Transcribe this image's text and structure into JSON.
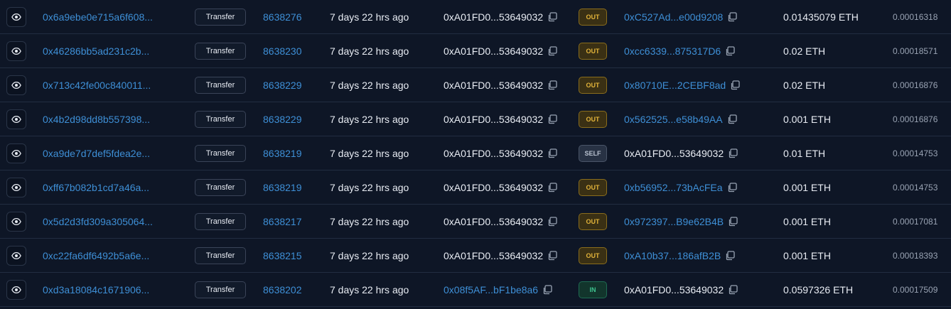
{
  "colors": {
    "background": "#0e1626",
    "link": "#3e8fd6",
    "out_badge": "#e2b33a",
    "self_badge": "#b8c1cf",
    "in_badge": "#3fc38f"
  },
  "rows": [
    {
      "hash": "0x6a9ebe0e715a6f608...",
      "method": "Transfer",
      "block": "8638276",
      "age": "7 days 22 hrs ago",
      "from": "0xA01FD0...53649032",
      "from_is_link": false,
      "direction": "OUT",
      "to": "0xC527Ad...e00d9208",
      "to_is_link": true,
      "value": "0.01435079 ETH",
      "fee": "0.00016318"
    },
    {
      "hash": "0x46286bb5ad231c2b...",
      "method": "Transfer",
      "block": "8638230",
      "age": "7 days 22 hrs ago",
      "from": "0xA01FD0...53649032",
      "from_is_link": false,
      "direction": "OUT",
      "to": "0xcc6339...875317D6",
      "to_is_link": true,
      "value": "0.02 ETH",
      "fee": "0.00018571"
    },
    {
      "hash": "0x713c42fe00c840011...",
      "method": "Transfer",
      "block": "8638229",
      "age": "7 days 22 hrs ago",
      "from": "0xA01FD0...53649032",
      "from_is_link": false,
      "direction": "OUT",
      "to": "0x80710E...2CEBF8ad",
      "to_is_link": true,
      "value": "0.02 ETH",
      "fee": "0.00016876"
    },
    {
      "hash": "0x4b2d98dd8b557398...",
      "method": "Transfer",
      "block": "8638229",
      "age": "7 days 22 hrs ago",
      "from": "0xA01FD0...53649032",
      "from_is_link": false,
      "direction": "OUT",
      "to": "0x562525...e58b49AA",
      "to_is_link": true,
      "value": "0.001 ETH",
      "fee": "0.00016876"
    },
    {
      "hash": "0xa9de7d7def5fdea2e...",
      "method": "Transfer",
      "block": "8638219",
      "age": "7 days 22 hrs ago",
      "from": "0xA01FD0...53649032",
      "from_is_link": false,
      "direction": "SELF",
      "to": "0xA01FD0...53649032",
      "to_is_link": false,
      "value": "0.01 ETH",
      "fee": "0.00014753"
    },
    {
      "hash": "0xff67b082b1cd7a46a...",
      "method": "Transfer",
      "block": "8638219",
      "age": "7 days 22 hrs ago",
      "from": "0xA01FD0...53649032",
      "from_is_link": false,
      "direction": "OUT",
      "to": "0xb56952...73bAcFEa",
      "to_is_link": true,
      "value": "0.001 ETH",
      "fee": "0.00014753"
    },
    {
      "hash": "0x5d2d3fd309a305064...",
      "method": "Transfer",
      "block": "8638217",
      "age": "7 days 22 hrs ago",
      "from": "0xA01FD0...53649032",
      "from_is_link": false,
      "direction": "OUT",
      "to": "0x972397...B9e62B4B",
      "to_is_link": true,
      "value": "0.001 ETH",
      "fee": "0.00017081"
    },
    {
      "hash": "0xc22fa6df6492b5a6e...",
      "method": "Transfer",
      "block": "8638215",
      "age": "7 days 22 hrs ago",
      "from": "0xA01FD0...53649032",
      "from_is_link": false,
      "direction": "OUT",
      "to": "0xA10b37...186afB2B",
      "to_is_link": true,
      "value": "0.001 ETH",
      "fee": "0.00018393"
    },
    {
      "hash": "0xd3a18084c1671906...",
      "method": "Transfer",
      "block": "8638202",
      "age": "7 days 22 hrs ago",
      "from": "0x08f5AF...bF1be8a6",
      "from_is_link": true,
      "direction": "IN",
      "to": "0xA01FD0...53649032",
      "to_is_link": false,
      "value": "0.0597326 ETH",
      "fee": "0.00017509"
    }
  ]
}
